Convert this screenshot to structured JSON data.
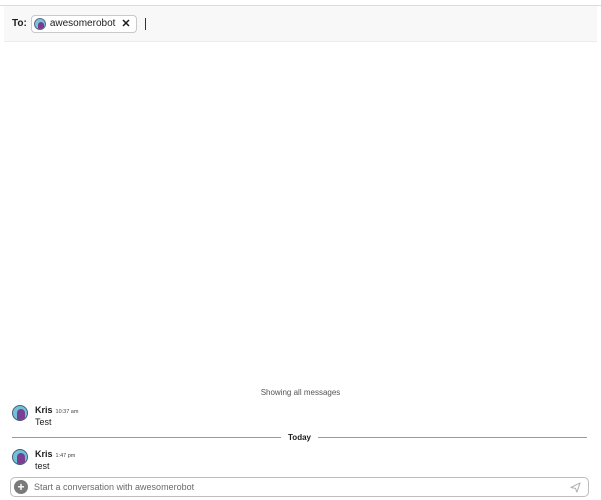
{
  "to_bar": {
    "label": "To:",
    "recipient": {
      "name": "awesomerobot",
      "icon": "avatar-icon"
    },
    "remove_icon": "close-icon",
    "remove_glyph": "✕"
  },
  "history_note": "Showing all messages",
  "messages": [
    {
      "author": "Kris",
      "time": "10:37 am",
      "text": "Test",
      "icon": "avatar-icon"
    },
    {
      "author": "Kris",
      "time": "1:47 pm",
      "text": "test",
      "icon": "avatar-icon"
    }
  ],
  "date_divider": "Today",
  "composer": {
    "placeholder": "Start a conversation with awesomerobot",
    "value": "",
    "add_icon": "plus-icon",
    "add_glyph": "+",
    "send_icon": "send-icon"
  },
  "colors": {
    "header_bg": "#f8f8f8",
    "avatar_bg": "#6fc3d6",
    "avatar_figure": "#7b3e93",
    "plus_bg": "#7a7a7a"
  }
}
